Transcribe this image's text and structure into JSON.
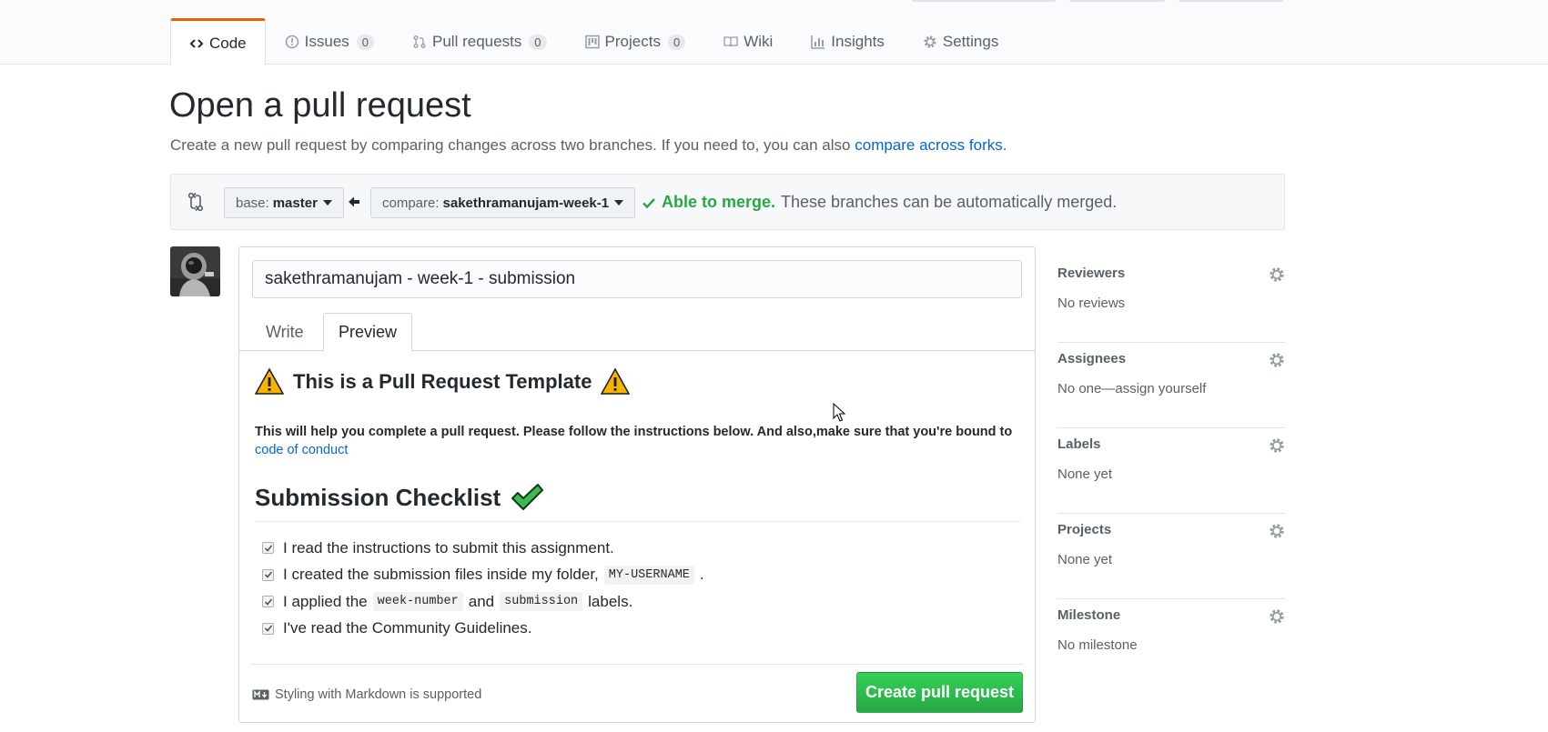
{
  "nav": {
    "code": "Code",
    "issues": "Issues",
    "issues_count": "0",
    "pulls": "Pull requests",
    "pulls_count": "0",
    "projects": "Projects",
    "projects_count": "0",
    "wiki": "Wiki",
    "insights": "Insights",
    "settings": "Settings"
  },
  "page": {
    "title": "Open a pull request",
    "description": "Create a new pull request by comparing changes across two branches. If you need to, you can also",
    "forks_link": "compare across forks",
    "period": "."
  },
  "range": {
    "base_prefix": "base:",
    "base_branch": "master",
    "compare_prefix": "compare:",
    "compare_branch": "sakethramanujam-week-1",
    "merge_ok": "Able to merge.",
    "merge_note": "These branches can be automatically merged."
  },
  "form": {
    "title_value": "sakethramanujam - week-1 - submission",
    "tab_write": "Write",
    "tab_preview": "Preview"
  },
  "preview": {
    "template_heading": "This is a Pull Request Template",
    "help_text": "This will help you complete a pull request. Please follow the instructions below. And also,make sure that you're bound to",
    "coc_link": "code of conduct",
    "checklist_heading": "Submission Checklist",
    "item1": "I read the instructions to submit this assignment.",
    "item2_pre": "I created the submission files inside my folder,",
    "item2_code": "MY-USERNAME",
    "item2_post": ".",
    "item3_pre": "I applied the",
    "item3_code1": "week-number",
    "item3_mid": "and",
    "item3_code2": "submission",
    "item3_post": "labels.",
    "item4": "I've read the Community Guidelines."
  },
  "footer": {
    "markdown_note": "Styling with Markdown is supported",
    "create_button": "Create pull request"
  },
  "sidebar": {
    "reviewers_title": "Reviewers",
    "reviewers_value": "No reviews",
    "assignees_title": "Assignees",
    "assignees_value": "No one—assign yourself",
    "labels_title": "Labels",
    "labels_value": "None yet",
    "projects_title": "Projects",
    "projects_value": "None yet",
    "milestone_title": "Milestone",
    "milestone_value": "No milestone"
  },
  "colors": {
    "accent_orange": "#e36209",
    "link_blue": "#0366d6",
    "success_green": "#28a745"
  }
}
